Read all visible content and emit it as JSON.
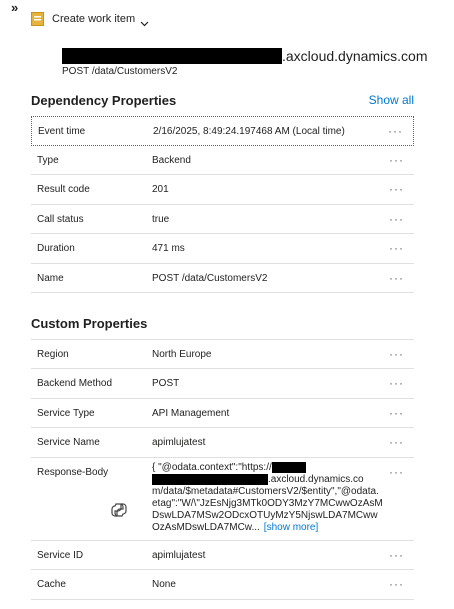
{
  "top": {
    "overflow_glyph": "»"
  },
  "toolbar": {
    "create_label": "Create work item",
    "icon": "work-item-icon",
    "dropdown_icon": "chevron-down-icon"
  },
  "header": {
    "host_suffix": ".axcloud.dynamics.com",
    "operation": "POST /data/CustomersV2"
  },
  "dependency": {
    "title": "Dependency Properties",
    "show_all": "Show all",
    "rows": [
      {
        "key": "Event time",
        "value": "2/16/2025, 8:49:24.197468 AM (Local time)"
      },
      {
        "key": "Type",
        "value": "Backend"
      },
      {
        "key": "Result code",
        "value": "201"
      },
      {
        "key": "Call status",
        "value": "true"
      },
      {
        "key": "Duration",
        "value": "471 ms"
      },
      {
        "key": "Name",
        "value": "POST /data/CustomersV2"
      }
    ]
  },
  "custom": {
    "title": "Custom Properties",
    "rows": [
      {
        "key": "Region",
        "value": "North Europe"
      },
      {
        "key": "Backend Method",
        "value": "POST"
      },
      {
        "key": "Service Type",
        "value": "API Management"
      },
      {
        "key": "Service Name",
        "value": "apimlujatest"
      }
    ],
    "response_body": {
      "key": "Response-Body",
      "line1": "{ \"@odata.context\":\"https://",
      "line2_suffix": ".axcloud.dynamics.co",
      "rest": "m/data/$metadata#CustomersV2/$entity\",\"@odata.etag\":\"W/\\\"JzEsNjg3MTk0ODY3MzY7MCwwOzAsMDswLDA7MSw2ODcxOTUyMzY5NjswLDA7MCwwOzAsMDswLDA7MCw...",
      "show_more": "[show more]"
    },
    "rows_after": [
      {
        "key": "Service ID",
        "value": "apimlujatest"
      },
      {
        "key": "Cache",
        "value": "None"
      }
    ]
  },
  "more_glyph": "···"
}
